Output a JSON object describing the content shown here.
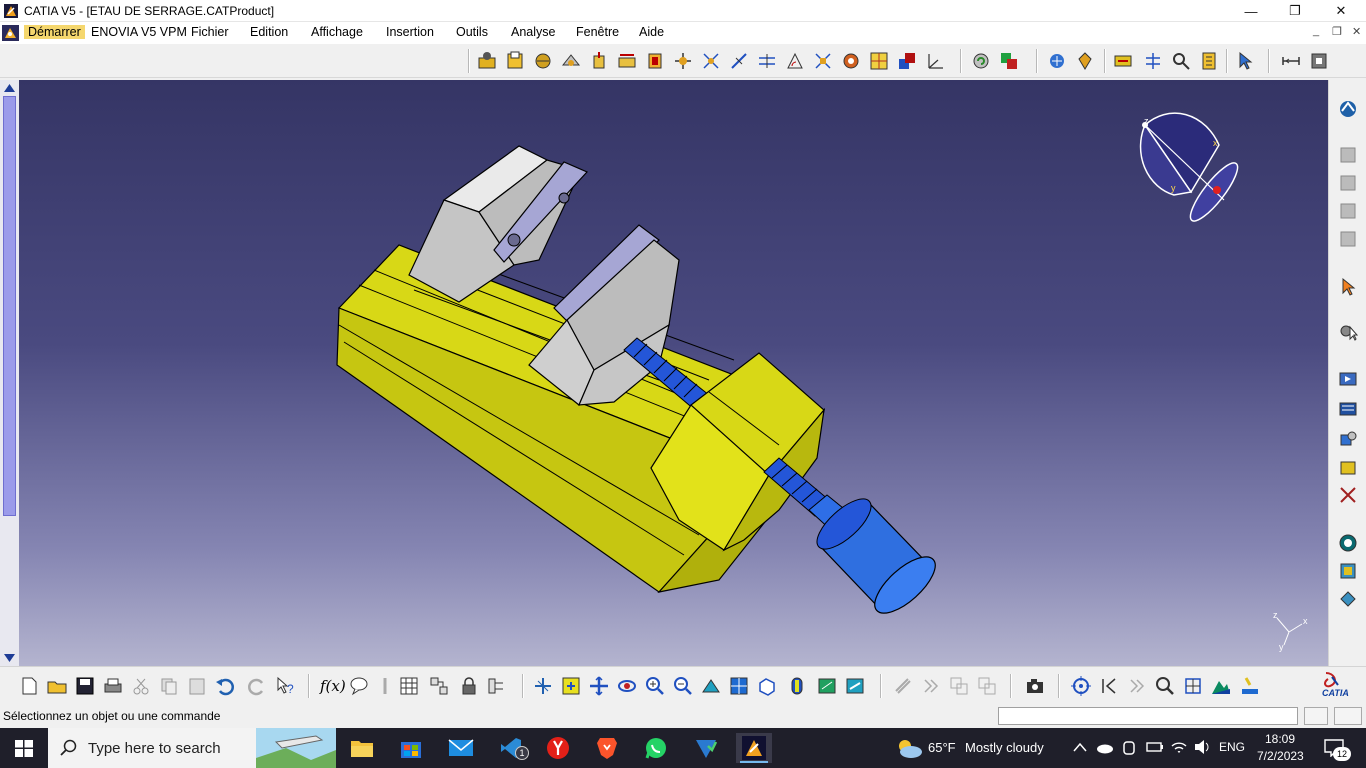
{
  "window": {
    "title": "CATIA V5 - [ETAU DE SERRAGE.CATProduct]",
    "minimize_label": "—",
    "maximize_label": "❐",
    "close_label": "✕"
  },
  "menubar": {
    "items": [
      "Démarrer",
      "ENOVIA V5 VPM",
      "Fichier",
      "Edition",
      "Affichage",
      "Insertion",
      "Outils",
      "Analyse",
      "Fenêtre",
      "Aide"
    ],
    "mdi_min": "_",
    "mdi_restore": "❐",
    "mdi_close": "✕"
  },
  "viewport": {
    "compass": {
      "x_label": "x",
      "y_label": "y",
      "z_label": "z"
    },
    "axis_triad": {
      "x_label": "x",
      "y_label": "y",
      "z_label": "z"
    },
    "colors": {
      "base": "#d4d414",
      "jaw": "#c8c8c8",
      "jaw_face": "#a9a9d6",
      "screw": "#2456d8",
      "handle": "#2f6fe0"
    }
  },
  "bottom_toolbar": {
    "fx_label": "f(x)",
    "catia_logo": "CATIA"
  },
  "statusbar": {
    "message": "Sélectionnez un objet ou une commande",
    "command_value": ""
  },
  "taskbar": {
    "search_placeholder": "Type here to search",
    "weather_temp": "65°F",
    "weather_desc": "Mostly cloudy",
    "language": "ENG",
    "time": "18:09",
    "date": "7/2/2023",
    "notifications": "12",
    "vscode_badge": "1"
  }
}
